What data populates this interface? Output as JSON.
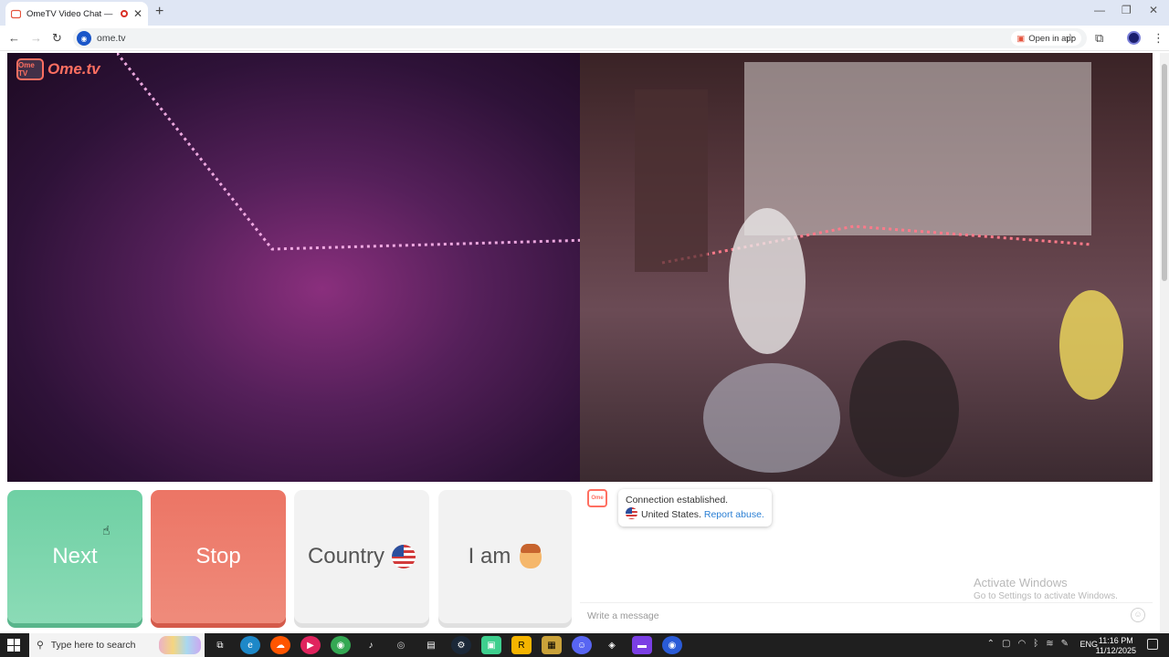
{
  "browser": {
    "tab_title": "OmeTV Video Chat — Ome",
    "url": "ome.tv",
    "open_in_app": "Open in app"
  },
  "logo": {
    "badge": "Ome TV",
    "word": "Ome.tv"
  },
  "buttons": {
    "next": "Next",
    "stop": "Stop",
    "country": "Country",
    "iam": "I am"
  },
  "chat": {
    "status": "Connection established.",
    "country": "United States.",
    "report": "Report abuse.",
    "placeholder": "Write a message"
  },
  "watermark": {
    "line1": "Activate Windows",
    "line2": "Go to Settings to activate Windows."
  },
  "taskbar": {
    "search_placeholder": "Type here to search",
    "lang": "ENG",
    "time": "11:16 PM",
    "date": "11/12/2025"
  },
  "colors": {
    "next": "#6fd0a4",
    "stop": "#ec7565",
    "brand": "#ff6f61",
    "link": "#2a7fd4"
  }
}
